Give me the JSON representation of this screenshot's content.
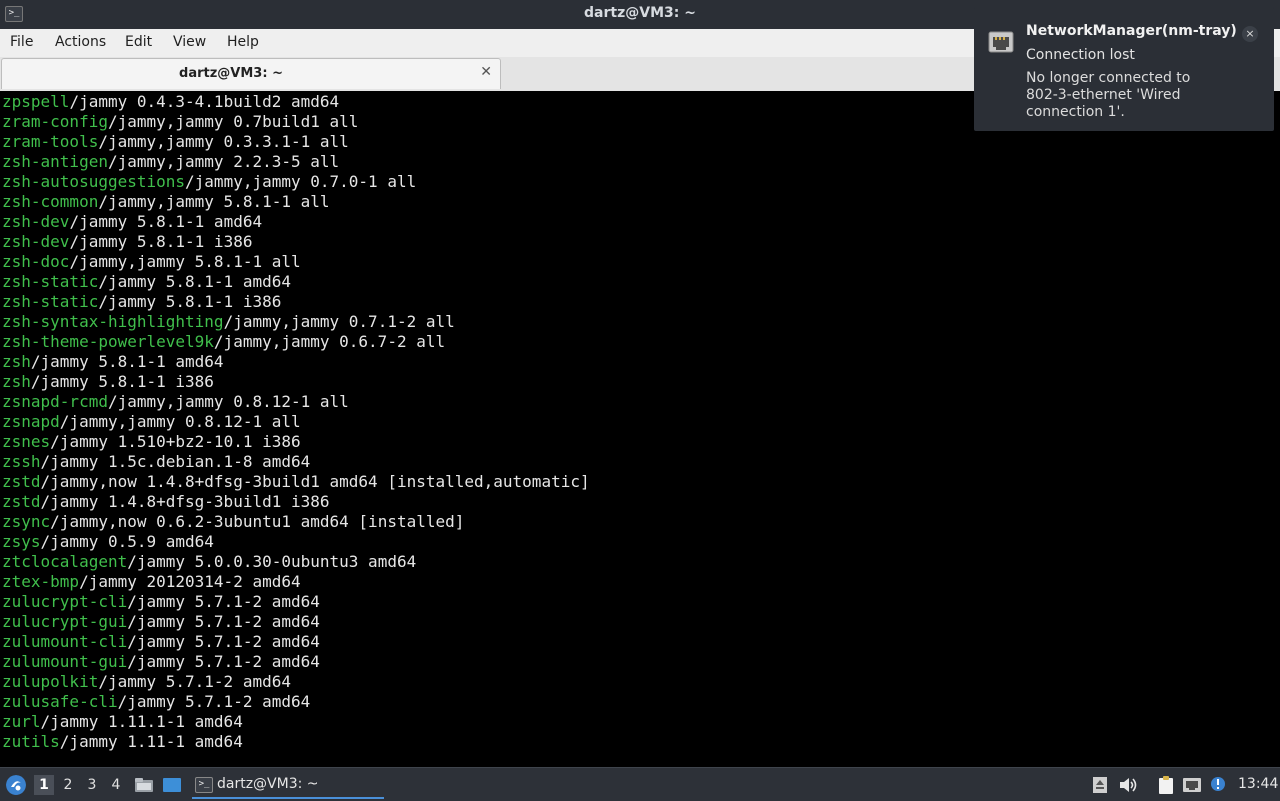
{
  "window": {
    "title": "dartz@VM3: ~"
  },
  "menu": [
    "File",
    "Actions",
    "Edit",
    "View",
    "Help"
  ],
  "tab": {
    "title": "dartz@VM3: ~"
  },
  "terminal_lines": [
    {
      "pkg": "zpspell",
      "rest": "/jammy 0.4.3-4.1build2 amd64"
    },
    {
      "pkg": "zram-config",
      "rest": "/jammy,jammy 0.7build1 all"
    },
    {
      "pkg": "zram-tools",
      "rest": "/jammy,jammy 0.3.3.1-1 all"
    },
    {
      "pkg": "zsh-antigen",
      "rest": "/jammy,jammy 2.2.3-5 all"
    },
    {
      "pkg": "zsh-autosuggestions",
      "rest": "/jammy,jammy 0.7.0-1 all"
    },
    {
      "pkg": "zsh-common",
      "rest": "/jammy,jammy 5.8.1-1 all"
    },
    {
      "pkg": "zsh-dev",
      "rest": "/jammy 5.8.1-1 amd64"
    },
    {
      "pkg": "zsh-dev",
      "rest": "/jammy 5.8.1-1 i386"
    },
    {
      "pkg": "zsh-doc",
      "rest": "/jammy,jammy 5.8.1-1 all"
    },
    {
      "pkg": "zsh-static",
      "rest": "/jammy 5.8.1-1 amd64"
    },
    {
      "pkg": "zsh-static",
      "rest": "/jammy 5.8.1-1 i386"
    },
    {
      "pkg": "zsh-syntax-highlighting",
      "rest": "/jammy,jammy 0.7.1-2 all"
    },
    {
      "pkg": "zsh-theme-powerlevel9k",
      "rest": "/jammy,jammy 0.6.7-2 all"
    },
    {
      "pkg": "zsh",
      "rest": "/jammy 5.8.1-1 amd64"
    },
    {
      "pkg": "zsh",
      "rest": "/jammy 5.8.1-1 i386"
    },
    {
      "pkg": "zsnapd-rcmd",
      "rest": "/jammy,jammy 0.8.12-1 all"
    },
    {
      "pkg": "zsnapd",
      "rest": "/jammy,jammy 0.8.12-1 all"
    },
    {
      "pkg": "zsnes",
      "rest": "/jammy 1.510+bz2-10.1 i386"
    },
    {
      "pkg": "zssh",
      "rest": "/jammy 1.5c.debian.1-8 amd64"
    },
    {
      "pkg": "zstd",
      "rest": "/jammy,now 1.4.8+dfsg-3build1 amd64 [installed,automatic]"
    },
    {
      "pkg": "zstd",
      "rest": "/jammy 1.4.8+dfsg-3build1 i386"
    },
    {
      "pkg": "zsync",
      "rest": "/jammy,now 0.6.2-3ubuntu1 amd64 [installed]"
    },
    {
      "pkg": "zsys",
      "rest": "/jammy 0.5.9 amd64"
    },
    {
      "pkg": "ztclocalagent",
      "rest": "/jammy 5.0.0.30-0ubuntu3 amd64"
    },
    {
      "pkg": "ztex-bmp",
      "rest": "/jammy 20120314-2 amd64"
    },
    {
      "pkg": "zulucrypt-cli",
      "rest": "/jammy 5.7.1-2 amd64"
    },
    {
      "pkg": "zulucrypt-gui",
      "rest": "/jammy 5.7.1-2 amd64"
    },
    {
      "pkg": "zulumount-cli",
      "rest": "/jammy 5.7.1-2 amd64"
    },
    {
      "pkg": "zulumount-gui",
      "rest": "/jammy 5.7.1-2 amd64"
    },
    {
      "pkg": "zulupolkit",
      "rest": "/jammy 5.7.1-2 amd64"
    },
    {
      "pkg": "zulusafe-cli",
      "rest": "/jammy 5.7.1-2 amd64"
    },
    {
      "pkg": "zurl",
      "rest": "/jammy 1.11.1-1 amd64"
    },
    {
      "pkg": "zutils",
      "rest": "/jammy 1.11-1 amd64"
    }
  ],
  "notification": {
    "title": "NetworkManager(nm-tray)",
    "summary": "Connection lost",
    "body": "No longer connected to 802-3-ethernet 'Wired connection 1'.",
    "close": "×",
    "icon": "network-wired-icon"
  },
  "taskbar": {
    "desktops": [
      "1",
      "2",
      "3",
      "4"
    ],
    "active_desktop": "1",
    "task_label": "dartz@VM3: ~",
    "clock": "13:44"
  },
  "colors": {
    "package_name": "#40bf4c",
    "terminal_text": "#e6e6e6",
    "terminal_bg": "#000000"
  }
}
